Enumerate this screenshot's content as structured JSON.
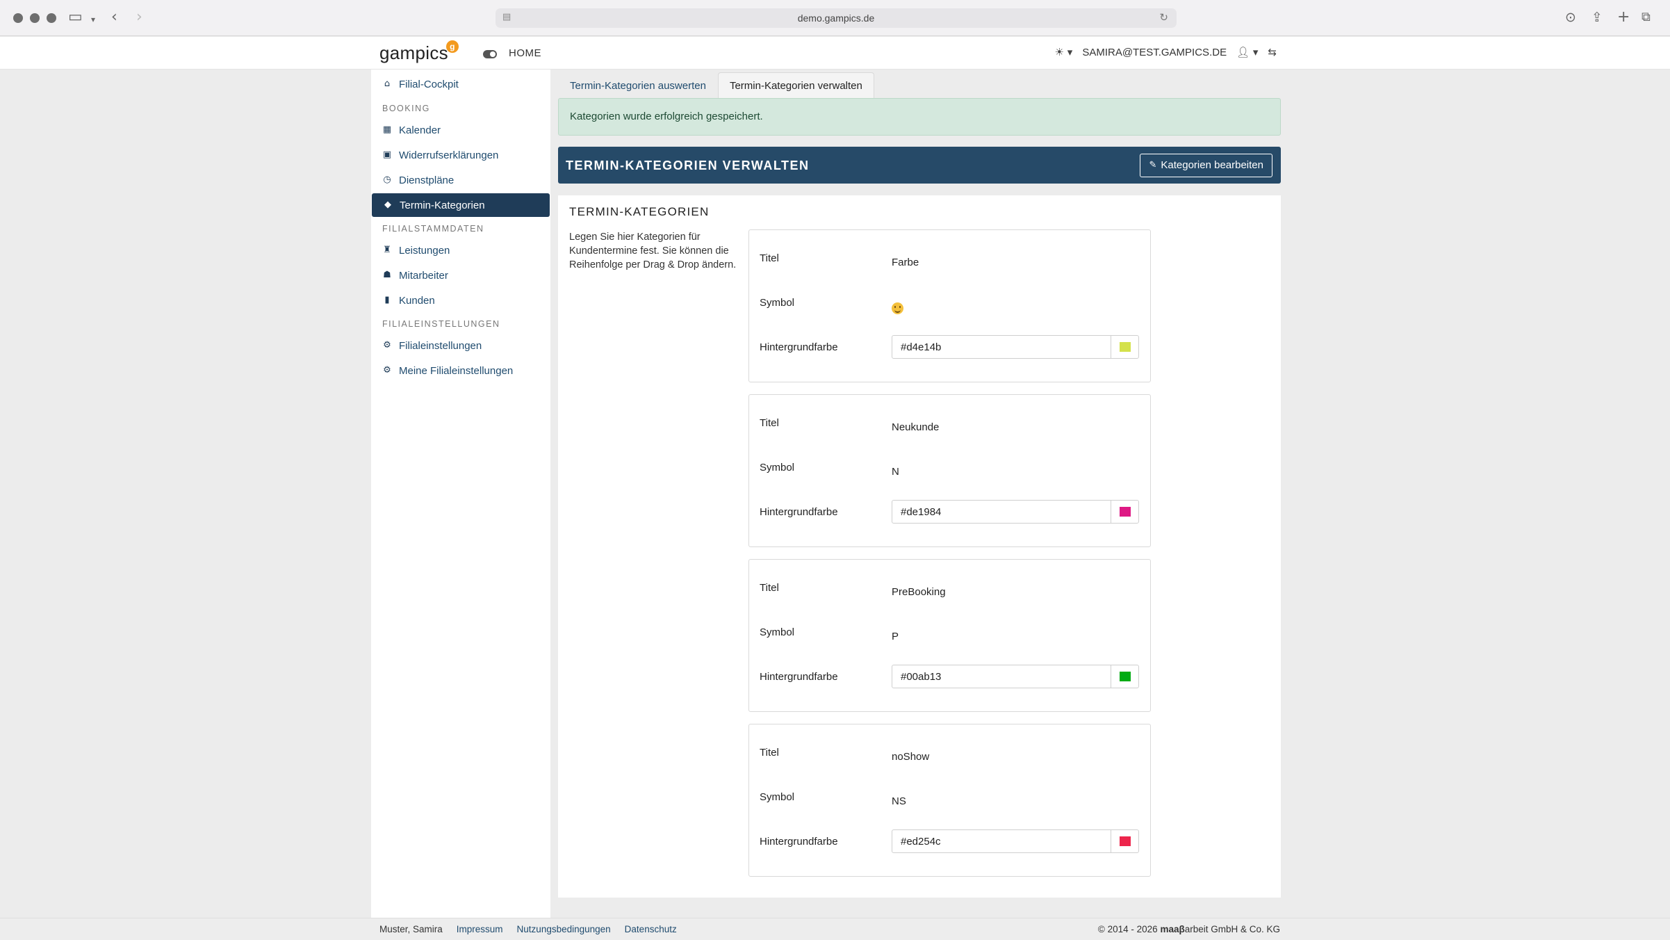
{
  "browser": {
    "url": "demo.gampics.de"
  },
  "header": {
    "logo": "gampics",
    "logo_badge": "g",
    "home_label": "HOME",
    "theme_icon": "☀",
    "user": "SAMIRA@TEST.GAMPICS.DE"
  },
  "sidebar": {
    "items": [
      {
        "label": "Filial-Cockpit",
        "icon": "home-icon"
      },
      {
        "section": "BOOKING"
      },
      {
        "label": "Kalender",
        "icon": "calendar-icon"
      },
      {
        "label": "Widerrufserklärungen",
        "icon": "calendar-minus-icon"
      },
      {
        "label": "Dienstpläne",
        "icon": "clock-icon"
      },
      {
        "label": "Termin-Kategorien",
        "icon": "tags-icon",
        "active": true
      },
      {
        "section": "FILIALSTAMMDATEN"
      },
      {
        "label": "Leistungen",
        "icon": "chair-icon"
      },
      {
        "label": "Mitarbeiter",
        "icon": "users-icon"
      },
      {
        "label": "Kunden",
        "icon": "address-book-icon"
      },
      {
        "section": "FILIALEINSTELLUNGEN"
      },
      {
        "label": "Filialeinstellungen",
        "icon": "gears-icon"
      },
      {
        "label": "Meine Filialeinstellungen",
        "icon": "user-gear-icon"
      }
    ]
  },
  "tabs": [
    {
      "label": "Termin-Kategorien auswerten",
      "active": false
    },
    {
      "label": "Termin-Kategorien verwalten",
      "active": true
    }
  ],
  "alert": "Kategorien wurde erfolgreich gespeichert.",
  "panel": {
    "title": "TERMIN-KATEGORIEN VERWALTEN",
    "edit_button": "Kategorien bearbeiten"
  },
  "section": {
    "title": "TERMIN-KATEGORIEN",
    "description": "Legen Sie hier Kategorien für Kundentermine fest. Sie können die Reihenfolge per Drag & Drop ändern."
  },
  "field_labels": {
    "title": "Titel",
    "symbol": "Symbol",
    "color": "Hintergrundfarbe"
  },
  "categories": [
    {
      "title": "Farbe",
      "symbol": "",
      "symbol_icon": "smiley-emoji",
      "color": "#d4e14b"
    },
    {
      "title": "Neukunde",
      "symbol": "N",
      "color": "#de1984"
    },
    {
      "title": "PreBooking",
      "symbol": "P",
      "color": "#00ab13"
    },
    {
      "title": "noShow",
      "symbol": "NS",
      "color": "#ed254c"
    }
  ],
  "footer": {
    "user": "Muster, Samira",
    "links": [
      "Impressum",
      "Nutzungsbedingungen",
      "Datenschutz"
    ],
    "copyright_prefix": "© 2014 - 2026 ",
    "copyright_brand": "maaβ",
    "copyright_suffix": "arbeit GmbH & Co. KG"
  }
}
